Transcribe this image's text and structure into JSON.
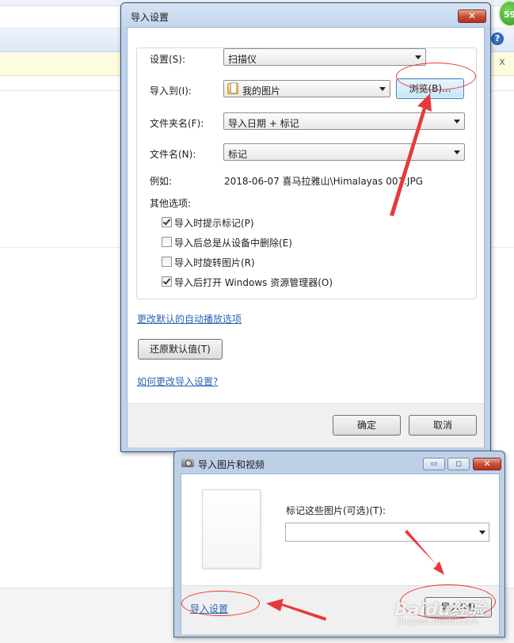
{
  "background": {
    "badge": "59",
    "help_icon": "help-icon",
    "close_glyph": "x"
  },
  "import_settings_dialog": {
    "title": "导入设置",
    "close_glyph": "✕",
    "settings_label": "设置(S):",
    "settings_value": "扫描仪",
    "import_to_label": "导入到(I):",
    "import_to_value": "我的图片",
    "browse_label": "浏览(B)...",
    "folder_name_label": "文件夹名(F):",
    "folder_name_value": "导入日期 + 标记",
    "file_name_label": "文件名(N):",
    "file_name_value": "标记",
    "example_label": "例如:",
    "example_value": "2018-06-07 喜马拉雅山\\Himalayas 001.JPG",
    "other_options_label": "其他选项:",
    "options": [
      {
        "label": "导入时提示标记(P)",
        "checked": true
      },
      {
        "label": "导入后总是从设备中删除(E)",
        "checked": false
      },
      {
        "label": "导入时旋转图片(R)",
        "checked": false
      },
      {
        "label": "导入后打开 Windows 资源管理器(O)",
        "checked": true
      }
    ],
    "change_autoplay_link": "更改默认的自动播放选项",
    "restore_defaults_label": "还原默认值(T)",
    "how_to_link": "如何更改导入设置?",
    "ok_label": "确定",
    "cancel_label": "取消"
  },
  "import_window": {
    "title": "导入图片和视频",
    "minimize_glyph": "▭",
    "maximize_glyph": "◻",
    "close_glyph": "✕",
    "tag_label": "标记这些图片(可选)(T):",
    "tag_value": "",
    "import_settings_link": "导入设置",
    "import_button_label": "导入(M)"
  },
  "annotation": {
    "color": "#e8393a"
  },
  "watermark": {
    "text": "Baidu经验",
    "sub": "jingyan.baidu.com"
  }
}
